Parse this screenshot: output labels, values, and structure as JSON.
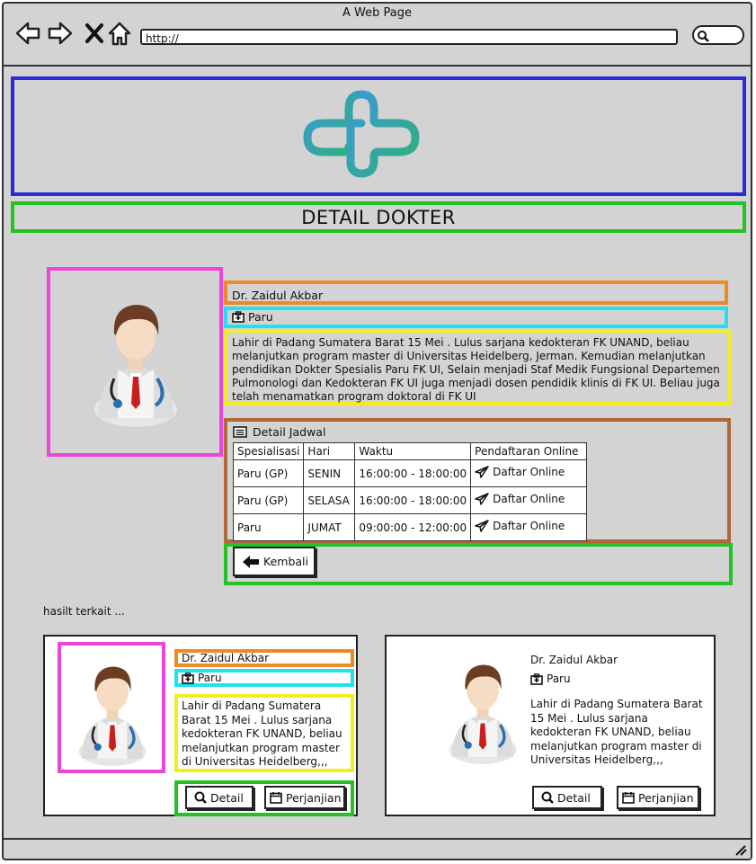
{
  "browser": {
    "window_title": "A Web Page",
    "url": "http://"
  },
  "page": {
    "title": "DETAIL DOKTER"
  },
  "doctor": {
    "name": "Dr. Zaidul Akbar",
    "specialty": "Paru",
    "bio": "Lahir di Padang Sumatera Barat 15 Mei . Lulus sarjana kedokteran FK UNAND, beliau melanjutkan program master di Universitas Heidelberg, Jerman. Kemudian melanjutkan pendidikan Dokter Spesialis Paru FK UI, Selain menjadi Staf Medik Fungsional Departemen Pulmonologi dan Kedokteran FK UI juga menjadi dosen pendidik klinis di FK UI. Beliau juga telah menamatkan program doktoral di FK UI"
  },
  "schedule": {
    "heading": "Detail Jadwal",
    "columns": [
      "Spesialisasi",
      "Hari",
      "Waktu",
      "Pendaftaran Online"
    ],
    "rows": [
      {
        "spesialisasi": "Paru (GP)",
        "hari": "SENIN",
        "waktu": "16:00:00 - 18:00:00",
        "action": "Daftar Online"
      },
      {
        "spesialisasi": "Paru (GP)",
        "hari": "SELASA",
        "waktu": "16:00:00 - 18:00:00",
        "action": "Daftar Online"
      },
      {
        "spesialisasi": "Paru",
        "hari": "JUMAT",
        "waktu": "09:00:00 - 12:00:00",
        "action": "Daftar Online"
      }
    ]
  },
  "back_button": {
    "label": "Kembali"
  },
  "related": {
    "heading": "hasilt terkait ...",
    "cards": [
      {
        "name": "Dr. Zaidul Akbar",
        "specialty": "Paru",
        "bio": "Lahir di Padang Sumatera Barat 15 Mei . Lulus sarjana kedokteran FK UNAND, beliau melanjutkan program master di Universitas Heidelberg,,,",
        "detail_label": "Detail",
        "appointment_label": "Perjanjian"
      },
      {
        "name": "Dr. Zaidul Akbar",
        "specialty": "Paru",
        "bio": "Lahir di Padang Sumatera Barat 15 Mei . Lulus sarjana kedokteran FK UNAND, beliau melanjutkan program master di Universitas Heidelberg,,,",
        "detail_label": "Detail",
        "appointment_label": "Perjanjian"
      }
    ]
  },
  "colors": {
    "header_box": "#2b2bd6",
    "title_box": "#22c322",
    "photo_box": "#ee44dd",
    "name_box": "#ee8a22",
    "specialty_box": "#22e0ee",
    "bio_box": "#f0ee22",
    "schedule_box": "#b0683a",
    "back_box": "#22c322",
    "logo_gradient_start": "#3a9ad8",
    "logo_gradient_end": "#2fb07a"
  }
}
